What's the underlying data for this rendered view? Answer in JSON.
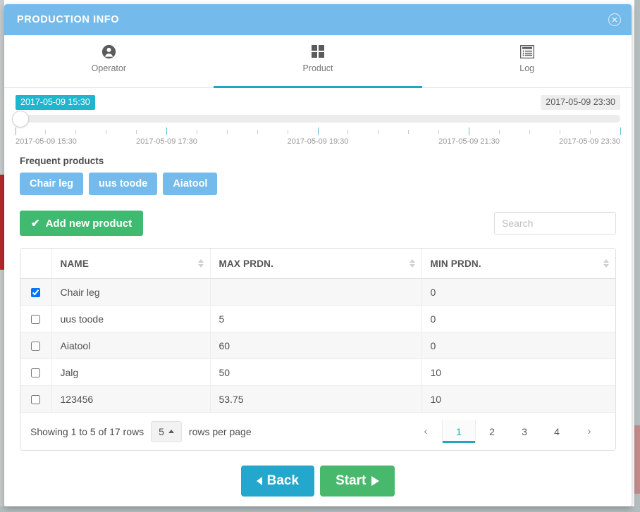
{
  "window": {
    "title": "PRODUCTION INFO",
    "close_icon": "close-circle-icon",
    "header_color": "#74bbec"
  },
  "tabs": [
    {
      "label": "Operator",
      "icon": "user-circle-icon",
      "active": false
    },
    {
      "label": "Product",
      "icon": "grid-squares-icon",
      "active": true
    },
    {
      "label": "Log",
      "icon": "list-window-icon",
      "active": false
    }
  ],
  "timeline": {
    "start_badge": "2017-05-09 15:30",
    "end_badge": "2017-05-09 23:30",
    "handle_position_pct": 0,
    "accent_color": "#20b5ce",
    "labels": [
      {
        "text": "2017-05-09 15:30",
        "pct": 0
      },
      {
        "text": "2017-05-09 17:30",
        "pct": 25
      },
      {
        "text": "2017-05-09 19:30",
        "pct": 50
      },
      {
        "text": "2017-05-09 21:30",
        "pct": 75
      },
      {
        "text": "2017-05-09 23:30",
        "pct": 100
      }
    ],
    "major_tick_pcts": [
      0,
      25,
      50,
      75,
      100
    ],
    "minor_tick_pcts": [
      5,
      10,
      15,
      20,
      30,
      35,
      40,
      45,
      55,
      60,
      65,
      70,
      80,
      85,
      90,
      95
    ]
  },
  "frequent": {
    "title": "Frequent products",
    "buttons": [
      "Chair leg",
      "uus toode",
      "Aiatool"
    ]
  },
  "actions": {
    "add_label": "Add new product",
    "add_icon": "check-icon",
    "add_color": "#41ba71",
    "search_placeholder": "Search",
    "search_value": ""
  },
  "table": {
    "columns": [
      "NAME",
      "MAX PRDN.",
      "MIN PRDN."
    ],
    "rows": [
      {
        "checked": true,
        "name": "Chair leg",
        "max": "",
        "min": "0"
      },
      {
        "checked": false,
        "name": "uus toode",
        "max": "5",
        "min": "0"
      },
      {
        "checked": false,
        "name": "Aiatool",
        "max": "60",
        "min": "0"
      },
      {
        "checked": false,
        "name": "Jalg",
        "max": "50",
        "min": "10"
      },
      {
        "checked": false,
        "name": "123456",
        "max": "53.75",
        "min": "10"
      }
    ]
  },
  "footer": {
    "showing_text": "Showing 1 to 5 of 17 rows",
    "rows_per_page_value": "5",
    "rows_per_page_label": "rows per page",
    "pager": {
      "prev": "‹",
      "next": "›",
      "pages": [
        "1",
        "2",
        "3",
        "4"
      ],
      "active_page": "1"
    }
  },
  "buttons": {
    "back_label": "Back",
    "back_icon": "chevron-left-icon",
    "back_color": "#24a7cc",
    "start_label": "Start",
    "start_icon": "play-triangle-icon",
    "start_color": "#48b96c"
  }
}
